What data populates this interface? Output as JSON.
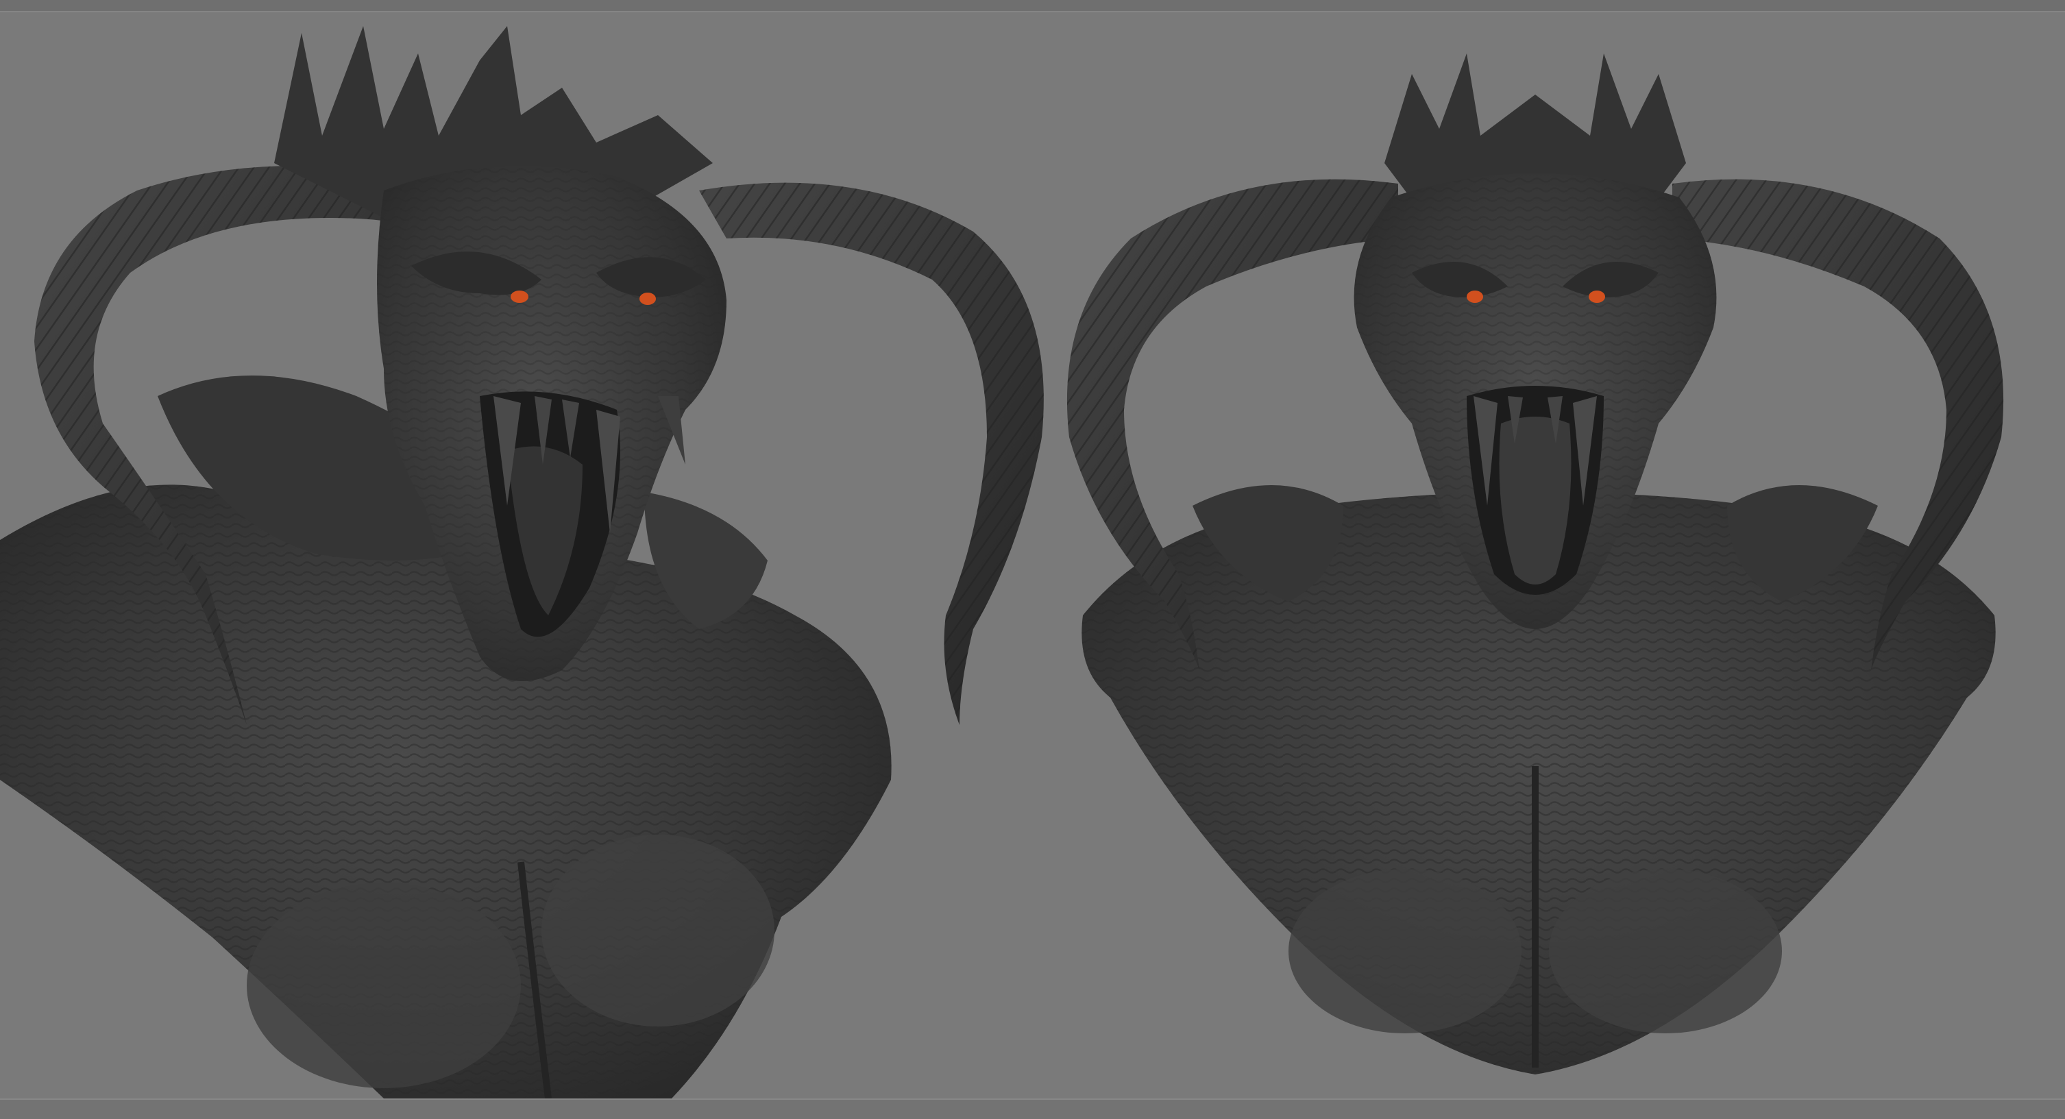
{
  "viewport": {
    "background_color": "#7a7a7a",
    "frame_edge_color": "#878787"
  },
  "models": [
    {
      "name": "demon-bust-three-quarter-view",
      "material_color": "#3c3c3c",
      "eye_color": "#d2501e"
    },
    {
      "name": "demon-bust-front-view",
      "material_color": "#3a3a3a",
      "eye_color": "#d2501e"
    }
  ]
}
